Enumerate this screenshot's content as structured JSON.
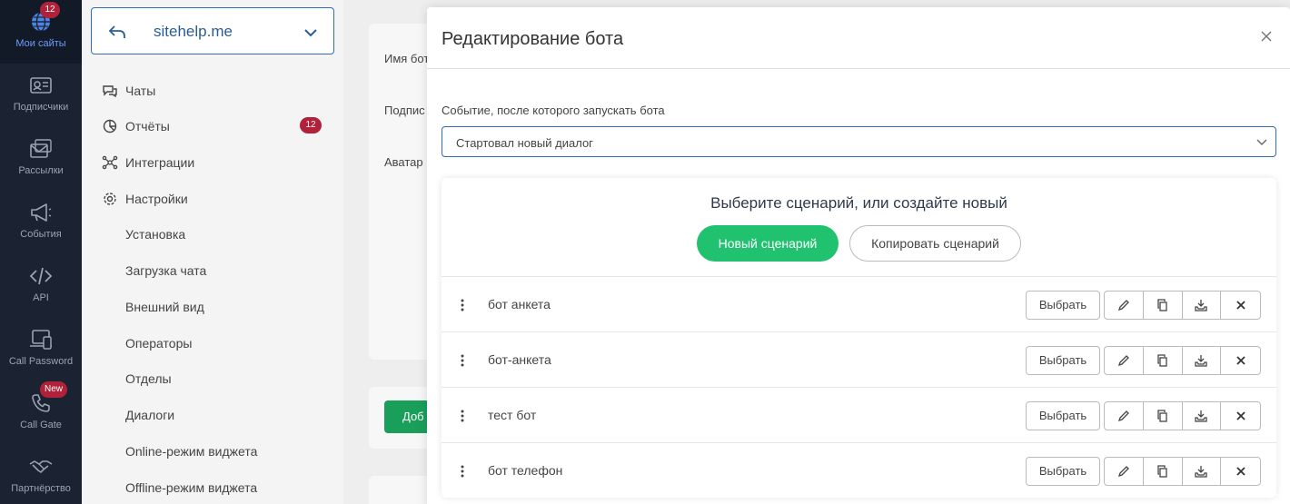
{
  "rail": {
    "items": [
      {
        "label": "Мои сайты",
        "icon": "globe-icon",
        "badge": "12"
      },
      {
        "label": "Подписчики",
        "icon": "contact-card-icon"
      },
      {
        "label": "Рассылки",
        "icon": "mail-stack-icon"
      },
      {
        "label": "События",
        "icon": "megaphone-icon"
      },
      {
        "label": "API",
        "icon": "code-icon"
      },
      {
        "label": "Call Password",
        "icon": "devices-icon"
      },
      {
        "label": "Call Gate",
        "icon": "phone-icon",
        "badge": "New"
      },
      {
        "label": "Партнёрство",
        "icon": "handshake-icon"
      }
    ]
  },
  "site": {
    "name": "sitehelp.me"
  },
  "nav": {
    "items": [
      {
        "label": "Чаты",
        "icon": "chat-icon"
      },
      {
        "label": "Отчёты",
        "icon": "chart-pie-icon",
        "badge": "12"
      },
      {
        "label": "Интеграции",
        "icon": "network-icon"
      },
      {
        "label": "Настройки",
        "icon": "gear-icon"
      }
    ],
    "subitems": [
      "Установка",
      "Загрузка чата",
      "Внешний вид",
      "Операторы",
      "Отделы",
      "Диалоги",
      "Online-режим виджета",
      "Offline-режим виджета"
    ]
  },
  "background": {
    "labels": [
      "Имя бот",
      "Подпис",
      "Аватар"
    ],
    "button": "Доб"
  },
  "modal": {
    "title": "Редактирование бота",
    "event_label": "Событие, после которого запускать бота",
    "event_value": "Стартовал новый диалог",
    "scenario_heading": "Выберите сценарий, или создайте новый",
    "new_button": "Новый сценарий",
    "copy_button": "Копировать сценарий",
    "select_label": "Выбрать",
    "scenarios": [
      "бот анкета",
      "бот-анкета",
      "тест бот",
      "бот телефон"
    ]
  },
  "colors": {
    "rail_bg": "#1b2333",
    "accent_blue": "#2f6db4",
    "green": "#20c26f",
    "badge_red": "#b0213a"
  }
}
